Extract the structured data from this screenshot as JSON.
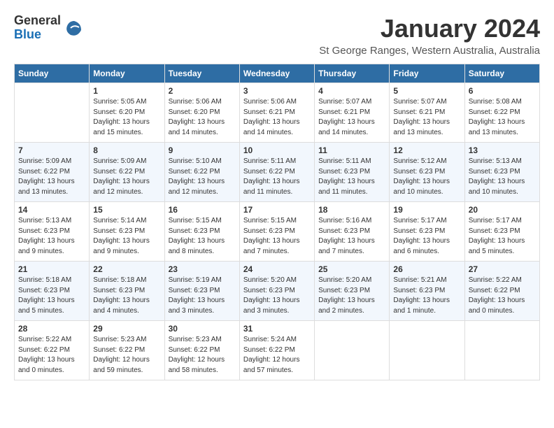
{
  "header": {
    "logo_line1": "General",
    "logo_line2": "Blue",
    "main_title": "January 2024",
    "subtitle": "St George Ranges, Western Australia, Australia"
  },
  "calendar": {
    "days_of_week": [
      "Sunday",
      "Monday",
      "Tuesday",
      "Wednesday",
      "Thursday",
      "Friday",
      "Saturday"
    ],
    "weeks": [
      [
        {
          "day": "",
          "info": ""
        },
        {
          "day": "1",
          "info": "Sunrise: 5:05 AM\nSunset: 6:20 PM\nDaylight: 13 hours\nand 15 minutes."
        },
        {
          "day": "2",
          "info": "Sunrise: 5:06 AM\nSunset: 6:20 PM\nDaylight: 13 hours\nand 14 minutes."
        },
        {
          "day": "3",
          "info": "Sunrise: 5:06 AM\nSunset: 6:21 PM\nDaylight: 13 hours\nand 14 minutes."
        },
        {
          "day": "4",
          "info": "Sunrise: 5:07 AM\nSunset: 6:21 PM\nDaylight: 13 hours\nand 14 minutes."
        },
        {
          "day": "5",
          "info": "Sunrise: 5:07 AM\nSunset: 6:21 PM\nDaylight: 13 hours\nand 13 minutes."
        },
        {
          "day": "6",
          "info": "Sunrise: 5:08 AM\nSunset: 6:22 PM\nDaylight: 13 hours\nand 13 minutes."
        }
      ],
      [
        {
          "day": "7",
          "info": "Sunrise: 5:09 AM\nSunset: 6:22 PM\nDaylight: 13 hours\nand 13 minutes."
        },
        {
          "day": "8",
          "info": "Sunrise: 5:09 AM\nSunset: 6:22 PM\nDaylight: 13 hours\nand 12 minutes."
        },
        {
          "day": "9",
          "info": "Sunrise: 5:10 AM\nSunset: 6:22 PM\nDaylight: 13 hours\nand 12 minutes."
        },
        {
          "day": "10",
          "info": "Sunrise: 5:11 AM\nSunset: 6:22 PM\nDaylight: 13 hours\nand 11 minutes."
        },
        {
          "day": "11",
          "info": "Sunrise: 5:11 AM\nSunset: 6:23 PM\nDaylight: 13 hours\nand 11 minutes."
        },
        {
          "day": "12",
          "info": "Sunrise: 5:12 AM\nSunset: 6:23 PM\nDaylight: 13 hours\nand 10 minutes."
        },
        {
          "day": "13",
          "info": "Sunrise: 5:13 AM\nSunset: 6:23 PM\nDaylight: 13 hours\nand 10 minutes."
        }
      ],
      [
        {
          "day": "14",
          "info": "Sunrise: 5:13 AM\nSunset: 6:23 PM\nDaylight: 13 hours\nand 9 minutes."
        },
        {
          "day": "15",
          "info": "Sunrise: 5:14 AM\nSunset: 6:23 PM\nDaylight: 13 hours\nand 9 minutes."
        },
        {
          "day": "16",
          "info": "Sunrise: 5:15 AM\nSunset: 6:23 PM\nDaylight: 13 hours\nand 8 minutes."
        },
        {
          "day": "17",
          "info": "Sunrise: 5:15 AM\nSunset: 6:23 PM\nDaylight: 13 hours\nand 7 minutes."
        },
        {
          "day": "18",
          "info": "Sunrise: 5:16 AM\nSunset: 6:23 PM\nDaylight: 13 hours\nand 7 minutes."
        },
        {
          "day": "19",
          "info": "Sunrise: 5:17 AM\nSunset: 6:23 PM\nDaylight: 13 hours\nand 6 minutes."
        },
        {
          "day": "20",
          "info": "Sunrise: 5:17 AM\nSunset: 6:23 PM\nDaylight: 13 hours\nand 5 minutes."
        }
      ],
      [
        {
          "day": "21",
          "info": "Sunrise: 5:18 AM\nSunset: 6:23 PM\nDaylight: 13 hours\nand 5 minutes."
        },
        {
          "day": "22",
          "info": "Sunrise: 5:18 AM\nSunset: 6:23 PM\nDaylight: 13 hours\nand 4 minutes."
        },
        {
          "day": "23",
          "info": "Sunrise: 5:19 AM\nSunset: 6:23 PM\nDaylight: 13 hours\nand 3 minutes."
        },
        {
          "day": "24",
          "info": "Sunrise: 5:20 AM\nSunset: 6:23 PM\nDaylight: 13 hours\nand 3 minutes."
        },
        {
          "day": "25",
          "info": "Sunrise: 5:20 AM\nSunset: 6:23 PM\nDaylight: 13 hours\nand 2 minutes."
        },
        {
          "day": "26",
          "info": "Sunrise: 5:21 AM\nSunset: 6:23 PM\nDaylight: 13 hours\nand 1 minute."
        },
        {
          "day": "27",
          "info": "Sunrise: 5:22 AM\nSunset: 6:22 PM\nDaylight: 13 hours\nand 0 minutes."
        }
      ],
      [
        {
          "day": "28",
          "info": "Sunrise: 5:22 AM\nSunset: 6:22 PM\nDaylight: 13 hours\nand 0 minutes."
        },
        {
          "day": "29",
          "info": "Sunrise: 5:23 AM\nSunset: 6:22 PM\nDaylight: 12 hours\nand 59 minutes."
        },
        {
          "day": "30",
          "info": "Sunrise: 5:23 AM\nSunset: 6:22 PM\nDaylight: 12 hours\nand 58 minutes."
        },
        {
          "day": "31",
          "info": "Sunrise: 5:24 AM\nSunset: 6:22 PM\nDaylight: 12 hours\nand 57 minutes."
        },
        {
          "day": "",
          "info": ""
        },
        {
          "day": "",
          "info": ""
        },
        {
          "day": "",
          "info": ""
        }
      ]
    ]
  }
}
